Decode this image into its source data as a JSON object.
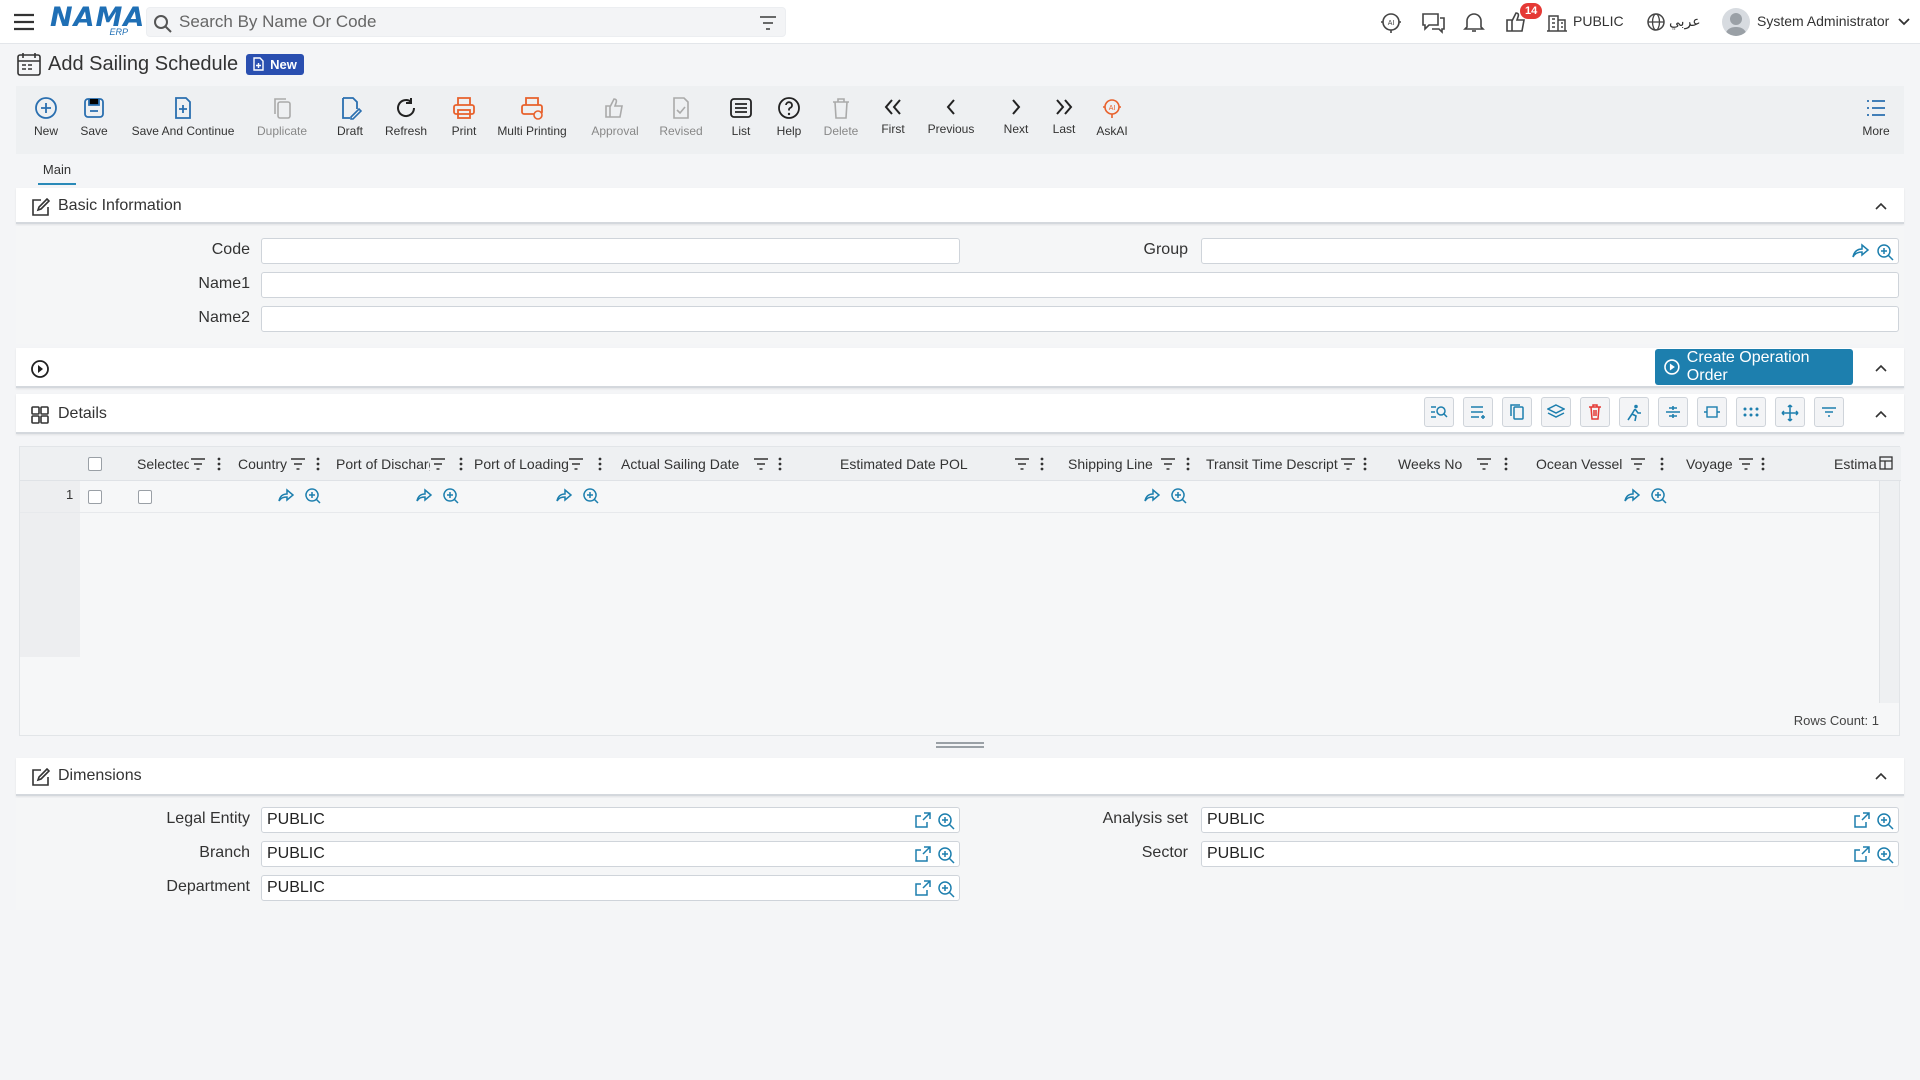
{
  "app": {
    "brand": "NAMA",
    "brand_sub": "ERP"
  },
  "search": {
    "placeholder": "Search By Name Or Code"
  },
  "topbar": {
    "notification_count": "14",
    "company": "PUBLIC",
    "language": "عربي",
    "user": "System Administrator"
  },
  "page": {
    "title": "Add Sailing Schedule",
    "status": "New"
  },
  "toolbar": {
    "new": "New",
    "save": "Save",
    "save_continue": "Save And Continue",
    "duplicate": "Duplicate",
    "draft": "Draft",
    "refresh": "Refresh",
    "print": "Print",
    "multi_printing": "Multi Printing",
    "approval": "Approval",
    "revised": "Revised",
    "list": "List",
    "help": "Help",
    "delete": "Delete",
    "first": "First",
    "previous": "Previous",
    "next": "Next",
    "last": "Last",
    "askai": "AskAI",
    "more": "More"
  },
  "tabs": {
    "main": "Main"
  },
  "basic": {
    "title": "Basic Information",
    "code_label": "Code",
    "code_value": "",
    "group_label": "Group",
    "group_value": "",
    "name1_label": "Name1",
    "name1_value": "",
    "name2_label": "Name2",
    "name2_value": ""
  },
  "actions": {
    "create_operation_order": "Create Operation Order"
  },
  "details": {
    "title": "Details",
    "columns": [
      "Selected",
      "Country",
      "Port of Discharge",
      "Port of Loading",
      "Actual Sailing Date",
      "Estimated Date POL",
      "Shipping Line",
      "Transit Time Description",
      "Weeks No",
      "Ocean Vessel",
      "Voyage",
      "Estima"
    ],
    "row_number": "1",
    "rows_count": "Rows Count: 1"
  },
  "dimensions": {
    "title": "Dimensions",
    "legal_entity_label": "Legal Entity",
    "legal_entity_value": "PUBLIC",
    "analysis_set_label": "Analysis set",
    "analysis_set_value": "PUBLIC",
    "branch_label": "Branch",
    "branch_value": "PUBLIC",
    "sector_label": "Sector",
    "sector_value": "PUBLIC",
    "department_label": "Department",
    "department_value": "PUBLIC"
  },
  "colors": {
    "primary": "#1d7fae",
    "brand": "#1f6fb5",
    "badge": "#2a4fb0",
    "danger": "#e53935",
    "print": "#e8612c"
  }
}
